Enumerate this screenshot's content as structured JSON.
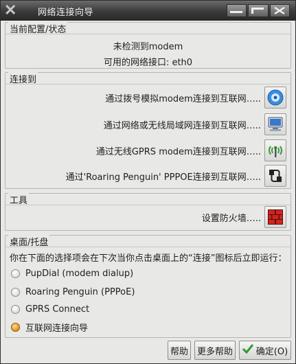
{
  "window": {
    "title": "网络连接向导"
  },
  "current_status": {
    "group_title": "当前配置/状态",
    "line1": "未检测到modem",
    "line2": "可用的网络接口: eth0"
  },
  "connect_to": {
    "group_title": "连接到",
    "items": [
      {
        "label": "通过拨号模拟modem连接到互联网…..",
        "icon": "modem-disc-icon"
      },
      {
        "label": "通过网络或无线局域网连接到互联网…..",
        "icon": "network-computer-icon"
      },
      {
        "label": "通过无线GPRS modem连接到互联网…..",
        "icon": "wireless-antenna-icon"
      },
      {
        "label": "通过'Roaring Penguin' PPPOE连接到互联网…..",
        "icon": "ethernet-plug-icon"
      }
    ]
  },
  "tools": {
    "group_title": "工具",
    "firewall_label": "设置防火墙…..",
    "firewall_icon": "firewall-brick-icon"
  },
  "desktop_tray": {
    "group_title": "桌面/托盘",
    "description": "你在下面的选择项会在下次当你点击桌面上的“连接”图标后立即运行：",
    "options": [
      {
        "label": "PupDial (modem dialup)",
        "checked": false
      },
      {
        "label": "Roaring Penguin (PPPoE)",
        "checked": false
      },
      {
        "label": "GPRS Connect",
        "checked": false
      },
      {
        "label": "互联网连接向导",
        "checked": true
      }
    ]
  },
  "buttons": {
    "help": "帮助",
    "more_help": "更多帮助",
    "ok": "确定(O)"
  },
  "colors": {
    "accent_radio": "#e0921e",
    "titlebar": "#3b3b3b",
    "firewall_red": "#c0201a"
  }
}
